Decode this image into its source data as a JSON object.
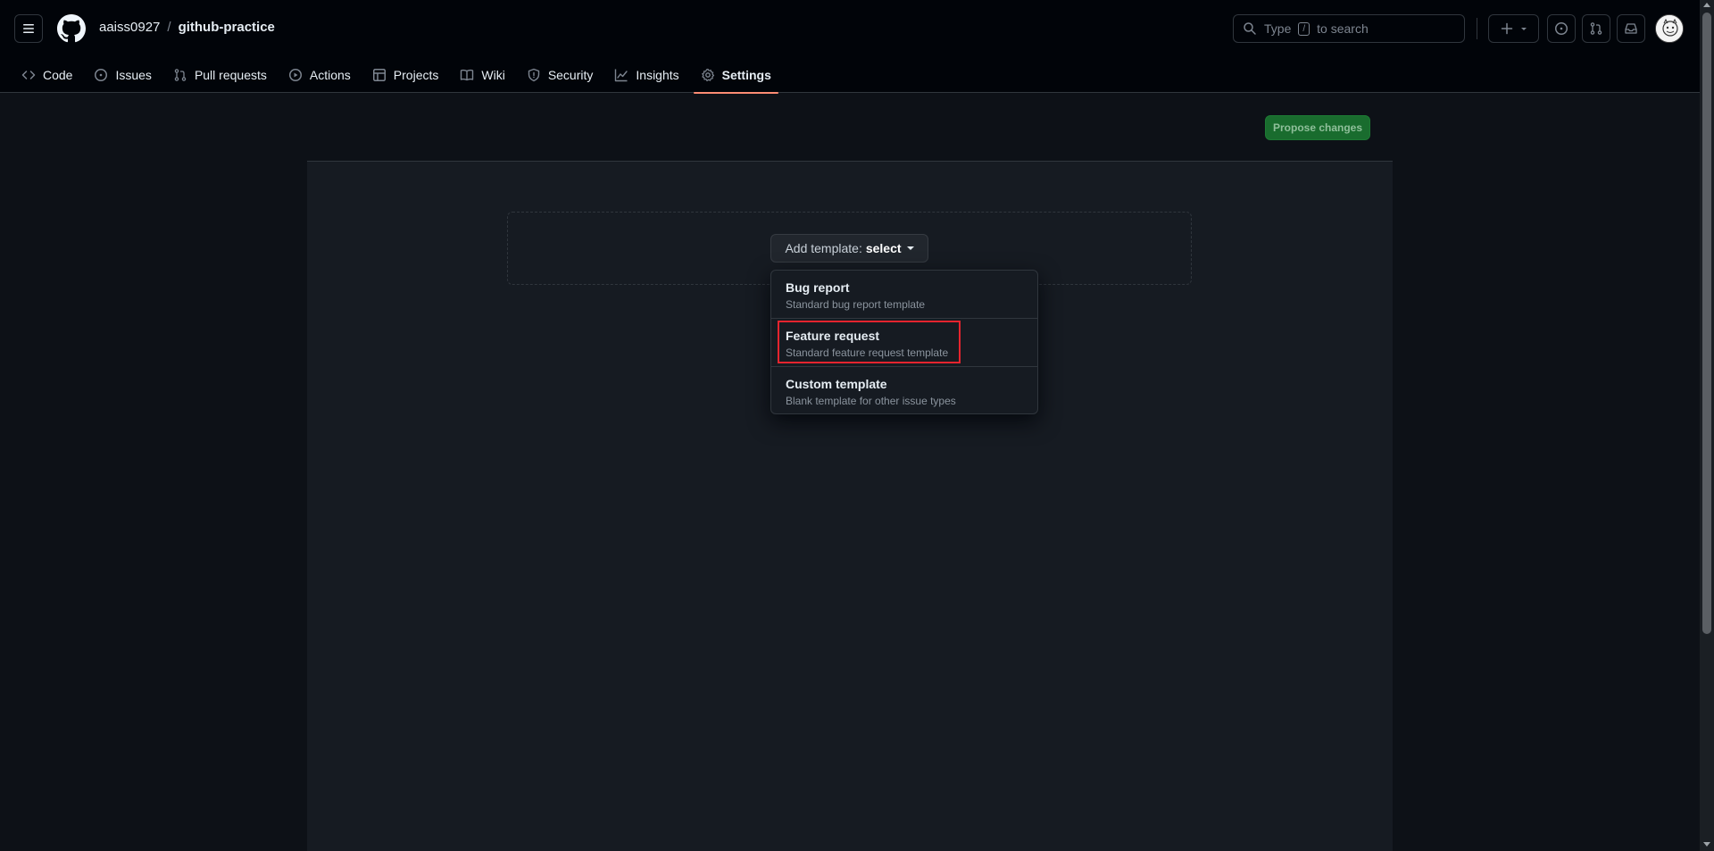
{
  "header": {
    "owner": "aaiss0927",
    "separator": "/",
    "repo": "github-practice",
    "search": {
      "prefix": "Type",
      "key": "/",
      "suffix": "to search"
    }
  },
  "nav": {
    "items": [
      {
        "label": "Code",
        "icon": "code-icon"
      },
      {
        "label": "Issues",
        "icon": "issue-opened-icon"
      },
      {
        "label": "Pull requests",
        "icon": "git-pull-request-icon"
      },
      {
        "label": "Actions",
        "icon": "play-icon"
      },
      {
        "label": "Projects",
        "icon": "table-icon"
      },
      {
        "label": "Wiki",
        "icon": "book-icon"
      },
      {
        "label": "Security",
        "icon": "shield-icon"
      },
      {
        "label": "Insights",
        "icon": "graph-icon"
      },
      {
        "label": "Settings",
        "icon": "gear-icon",
        "active": true
      }
    ]
  },
  "main": {
    "propose_label": "Propose changes",
    "template_button": {
      "label": "Add template:",
      "value": "select"
    },
    "menu": {
      "items": [
        {
          "title": "Bug report",
          "description": "Standard bug report template"
        },
        {
          "title": "Feature request",
          "description": "Standard feature request template",
          "highlighted": true
        },
        {
          "title": "Custom template",
          "description": "Blank template for other issue types"
        }
      ]
    }
  },
  "colors": {
    "background": "#0d1117",
    "header": "#010409",
    "panel": "#161b22",
    "propose_button": "#196c2e",
    "active_underline": "#fd8c73",
    "highlight": "#e5242e"
  }
}
